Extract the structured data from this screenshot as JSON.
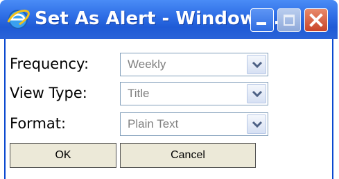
{
  "window": {
    "title": "Set As Alert - Windows ...",
    "icon": "ie-icon",
    "controls": {
      "minimize": "minimize-icon",
      "maximize": "maximize-icon",
      "close": "close-icon"
    }
  },
  "form": {
    "fields": [
      {
        "label": "Frequency:",
        "value": "Weekly"
      },
      {
        "label": "View Type:",
        "value": "Title"
      },
      {
        "label": "Format:",
        "value": "Plain Text"
      }
    ]
  },
  "buttons": {
    "ok": "OK",
    "cancel": "Cancel"
  },
  "colors": {
    "titlebar": "#2f6fe6",
    "close": "#c9452a",
    "button_face": "#ece9d8"
  }
}
